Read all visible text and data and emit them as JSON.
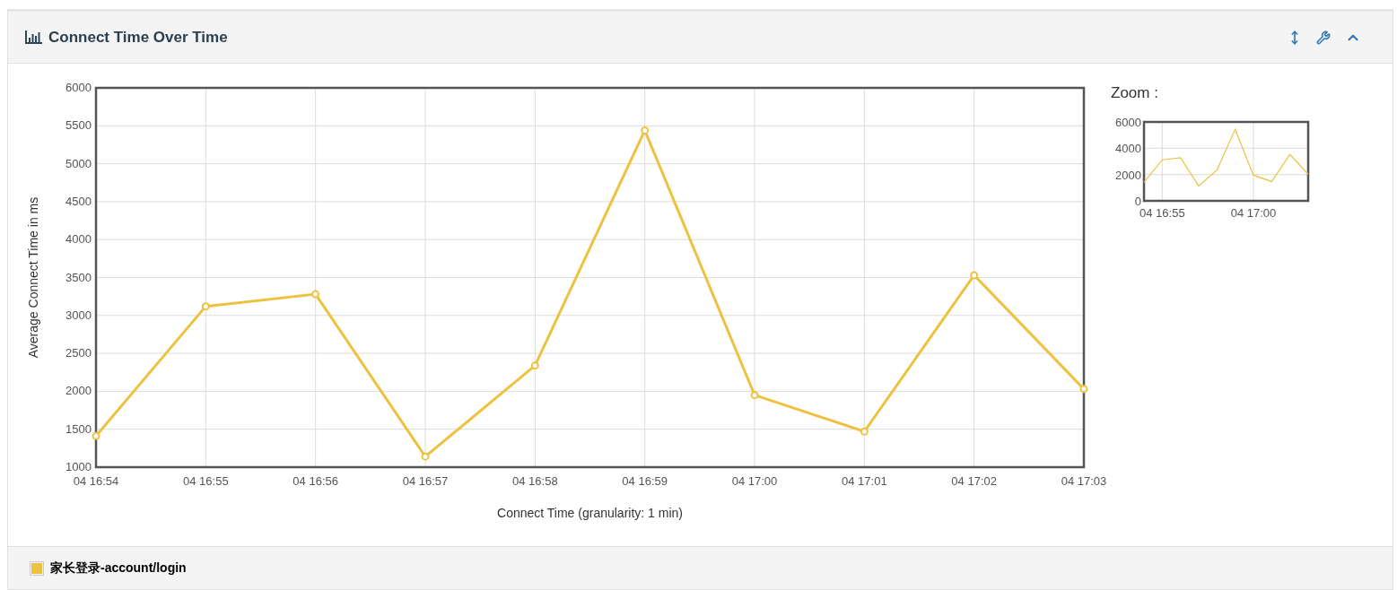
{
  "panel": {
    "title": "Connect Time Over Time"
  },
  "chart": {
    "chart_data": {
      "type": "line",
      "xlabel": "Connect Time (granularity: 1 min)",
      "ylabel": "Average Connect Time in ms",
      "grid": true,
      "categories": [
        "04 16:54",
        "04 16:55",
        "04 16:56",
        "04 16:57",
        "04 16:58",
        "04 16:59",
        "04 17:00",
        "04 17:01",
        "04 17:02",
        "04 17:03"
      ],
      "series": [
        {
          "name": "家长登录-account/login",
          "color": "#edc240",
          "marker": "circle",
          "values": [
            1410,
            3120,
            3280,
            1140,
            2340,
            5440,
            1950,
            1470,
            3530,
            2030
          ]
        }
      ],
      "ylim": [
        1000,
        6000
      ],
      "yticks": [
        1000,
        1500,
        2000,
        2500,
        3000,
        3500,
        4000,
        4500,
        5000,
        5500,
        6000
      ]
    }
  },
  "zoom": {
    "label": "Zoom :",
    "chart_data": {
      "type": "line",
      "grid": true,
      "categories": [
        null,
        "04 16:55",
        null,
        null,
        null,
        null,
        "04 17:00",
        null,
        null,
        null
      ],
      "series": [
        {
          "color": "#edc240",
          "values": [
            1410,
            3120,
            3280,
            1140,
            2340,
            5440,
            1950,
            1470,
            3530,
            2030
          ]
        }
      ],
      "ylim": [
        0,
        6000
      ],
      "yticks": [
        0,
        2000,
        4000,
        6000
      ]
    }
  }
}
